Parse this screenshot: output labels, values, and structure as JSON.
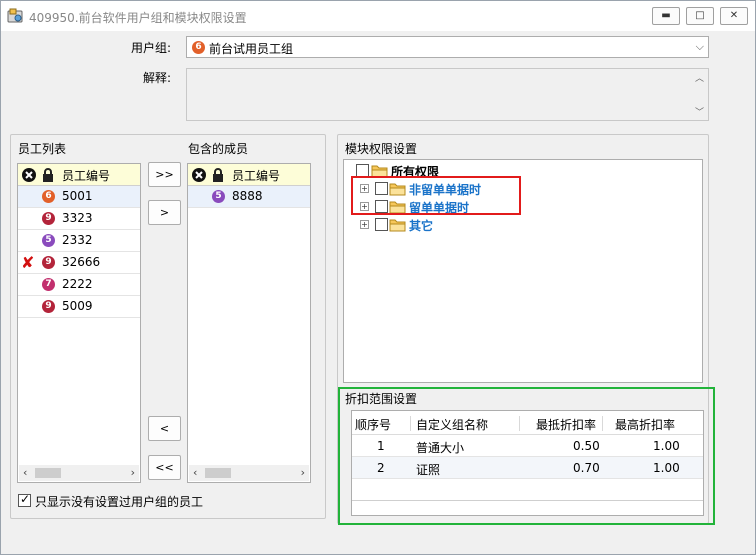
{
  "window": {
    "title": "409950.前台软件用户组和模块权限设置"
  },
  "form": {
    "usergroup_label": "用户组:",
    "usergroup_value": "前台试用员工组",
    "usergroup_badge": "6",
    "explain_label": "解释:"
  },
  "employee_list": {
    "title": "员工列表",
    "column": "员工编号",
    "rows": [
      {
        "badge": "6",
        "id": "5001",
        "color": "#e2602a",
        "removed": ""
      },
      {
        "badge": "9",
        "id": "3323",
        "color": "#b3243a",
        "removed": ""
      },
      {
        "badge": "5",
        "id": "2332",
        "color": "#8a4bbd",
        "removed": ""
      },
      {
        "badge": "9",
        "id": "32666",
        "color": "#b3243a",
        "removed": "✘"
      },
      {
        "badge": "7",
        "id": "2222",
        "color": "#c2306e",
        "removed": ""
      },
      {
        "badge": "9",
        "id": "5009",
        "color": "#b3243a",
        "removed": ""
      }
    ]
  },
  "members": {
    "title": "包含的成员",
    "column": "员工编号",
    "rows": [
      {
        "badge": "5",
        "id": "8888",
        "color": "#8a4bbd"
      }
    ]
  },
  "buttons": {
    "add_all": ">>",
    "add_one": ">",
    "remove_one": "<",
    "remove_all": "<<"
  },
  "filter": {
    "label": "只显示没有设置过用户组的员工",
    "checked": true
  },
  "permissions": {
    "title": "模块权限设置",
    "root": "所有权限",
    "nodes": [
      "非留单单据时",
      "留单单据时",
      "其它"
    ]
  },
  "discount": {
    "title": "折扣范围设置",
    "columns": [
      "顺序号",
      "自定义组名称",
      "最抵折扣率",
      "最高折扣率"
    ],
    "rows": [
      {
        "seq": "1",
        "name": "普通大小",
        "min": "0.50",
        "max": "1.00"
      },
      {
        "seq": "2",
        "name": "证照",
        "min": "0.70",
        "max": "1.00"
      }
    ]
  },
  "colors": {
    "accent_blue": "#1a73c9",
    "highlight_red": "#e21b1b",
    "highlight_green": "#22b33a"
  }
}
